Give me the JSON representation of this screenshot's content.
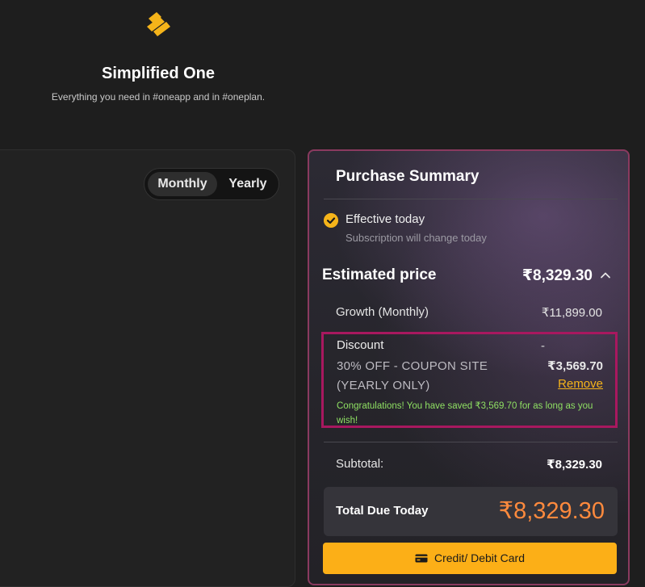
{
  "app": {
    "title": "Simplified One",
    "subtitle": "Everything you need in #oneapp and in #oneplan.",
    "logo": "simplified-logo-icon",
    "brand_color": "#f5b41a"
  },
  "billing_toggle": {
    "options": [
      "Monthly",
      "Yearly"
    ],
    "selected": "Monthly"
  },
  "summary": {
    "title": "Purchase Summary",
    "effective": {
      "icon": "check-circle-icon",
      "title": "Effective today",
      "subtitle": "Subscription will change today"
    },
    "estimated": {
      "label": "Estimated price",
      "value": "₹8,329.30",
      "expand_icon": "chevron-up-icon"
    },
    "plan": {
      "label": "Growth (Monthly)",
      "value": "₹11,899.00"
    },
    "discount": {
      "label": "Discount",
      "sign": "-",
      "code": "30% OFF - COUPON SITE (YEARLY ONLY)",
      "amount": "₹3,569.70",
      "remove_label": "Remove",
      "message": "Congratulations! You have saved ₹3,569.70 for as long as you wish!"
    },
    "subtotal": {
      "label": "Subtotal:",
      "value": "₹8,329.30"
    },
    "total": {
      "label": "Total Due Today",
      "value": "₹8,329.30",
      "color": "#ff8a3d"
    },
    "payment_button": {
      "icon": "credit-card-icon",
      "label": "Credit/ Debit Card"
    }
  }
}
